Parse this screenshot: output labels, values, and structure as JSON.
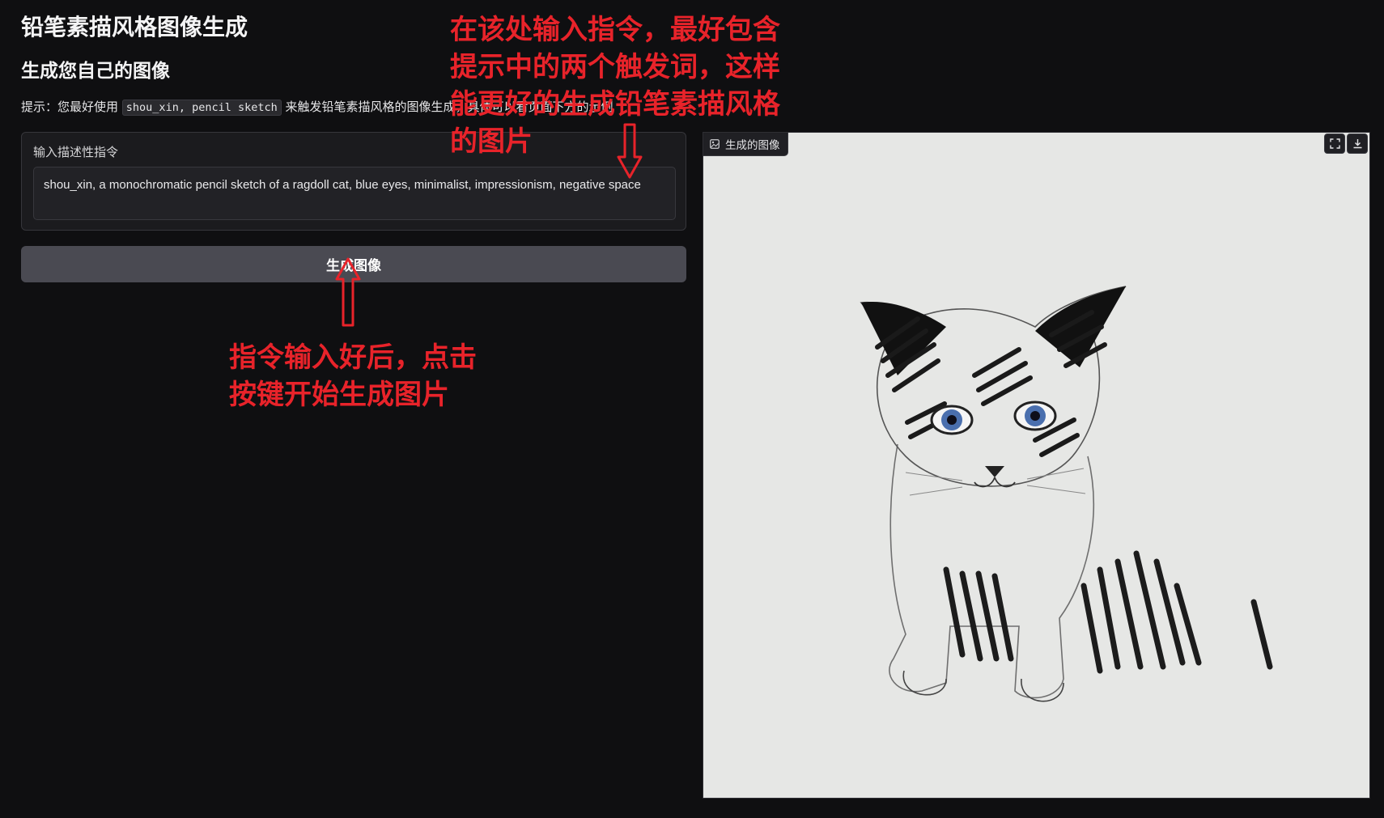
{
  "header": {
    "title": "铅笔素描风格图像生成",
    "subtitle": "生成您自己的图像"
  },
  "hint": {
    "prefix": "提示：您最好使用",
    "code": "shou_xin, pencil sketch",
    "suffix": "来触发铅笔素描风格的图像生成，具体可以看页面下方的示例"
  },
  "prompt": {
    "label": "输入描述性指令",
    "value": "shou_xin, a monochromatic pencil sketch of a ragdoll cat, blue eyes, minimalist, impressionism, negative space"
  },
  "generate_button": {
    "label": "生成图像"
  },
  "output_panel": {
    "label": "生成的图像",
    "icons": [
      "image-icon",
      "fullscreen-icon",
      "download-icon"
    ]
  },
  "annotations": {
    "top_lines": [
      "在该处输入指令，最好包含",
      "提示中的两个触发词，这样",
      "能更好的生成铅笔素描风格",
      "的图片"
    ],
    "bottom_lines": [
      "指令输入好后，点击",
      "按键开始生成图片"
    ],
    "color": "#e8232a"
  },
  "colors": {
    "background": "#0f0f11",
    "panel": "#1b1b1e",
    "button": "#4a4a52",
    "canvas": "#e6e7e5"
  }
}
